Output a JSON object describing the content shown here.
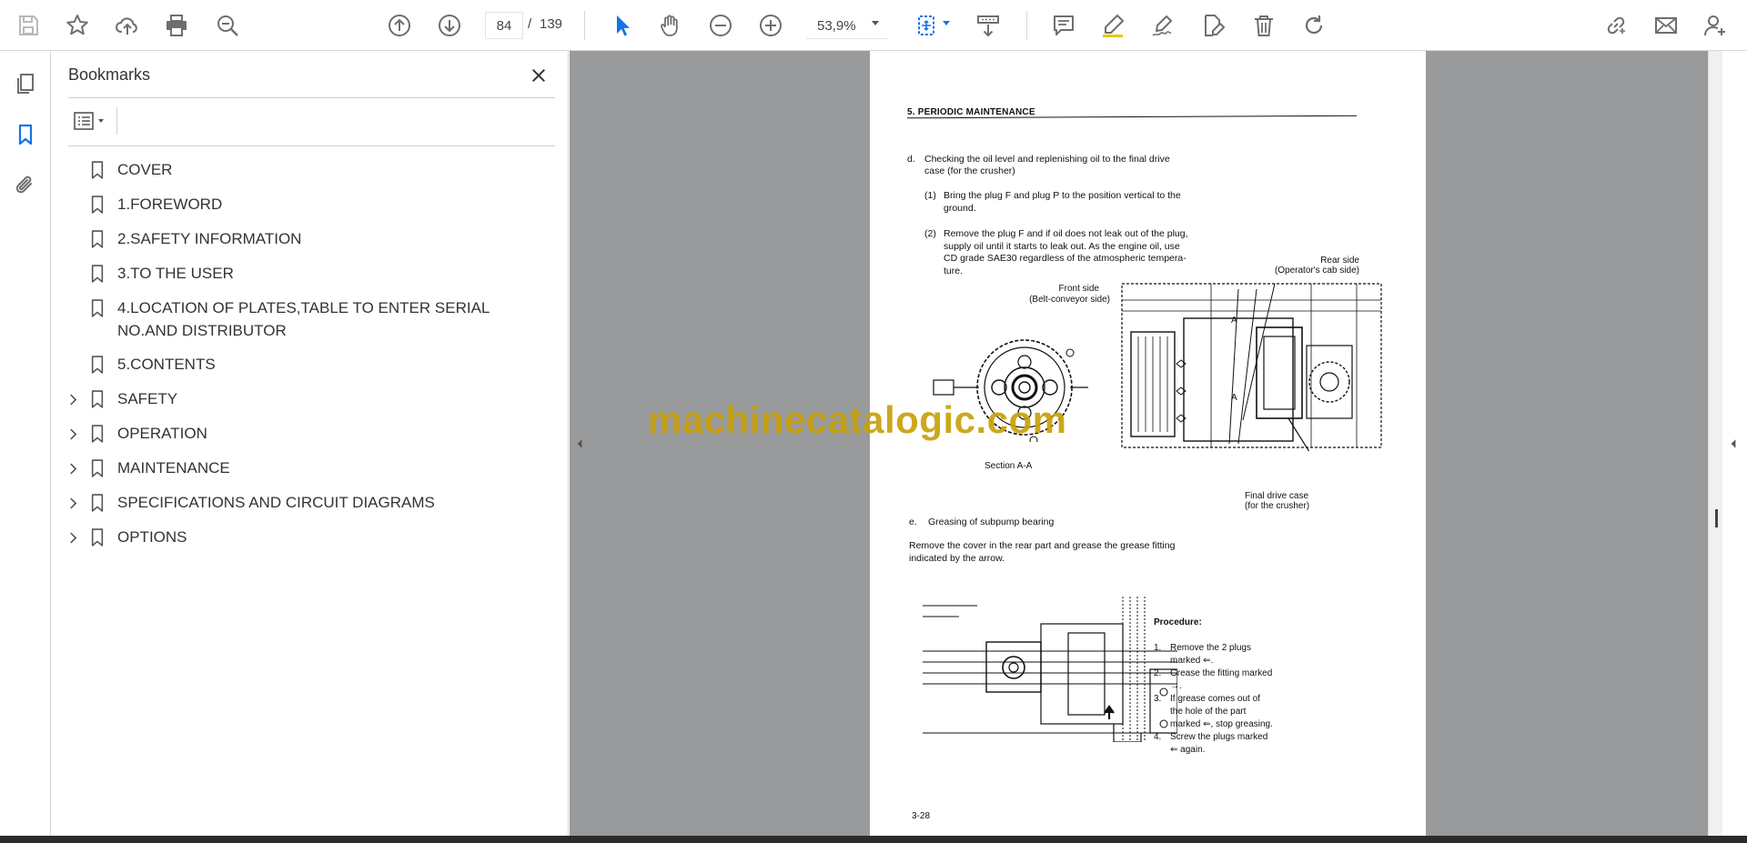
{
  "toolbar": {
    "page_current": "84",
    "page_separator": "/",
    "page_total": "139",
    "zoom": "53,9%",
    "accent_color": "#1473e6"
  },
  "left_rail": {
    "items": [
      "pages-icon",
      "bookmark-icon",
      "attachment-icon"
    ]
  },
  "bookmarks": {
    "title": "Bookmarks",
    "items": [
      {
        "label": "COVER",
        "expandable": false
      },
      {
        "label": "1.FOREWORD",
        "expandable": false
      },
      {
        "label": "2.SAFETY INFORMATION",
        "expandable": false
      },
      {
        "label": "3.TO THE USER",
        "expandable": false
      },
      {
        "label": "4.LOCATION OF PLATES,TABLE TO ENTER SERIAL NO.AND DISTRIBUTOR",
        "expandable": false
      },
      {
        "label": "5.CONTENTS",
        "expandable": false
      },
      {
        "label": "SAFETY",
        "expandable": true
      },
      {
        "label": "OPERATION",
        "expandable": true
      },
      {
        "label": "MAINTENANCE",
        "expandable": true
      },
      {
        "label": "SPECIFICATIONS AND CIRCUIT DIAGRAMS",
        "expandable": true
      },
      {
        "label": "OPTIONS",
        "expandable": true
      }
    ]
  },
  "page": {
    "header": "5.  PERIODIC MAINTENANCE",
    "d_label": "d.",
    "d_line1": "Checking the oil level and replenishing oil to the final drive",
    "d_line2": "case (for the crusher)",
    "s1_num": "(1)",
    "s1_line1": "Bring the plug F and plug P to the position vertical to the",
    "s1_line2": "ground.",
    "s2_num": "(2)",
    "s2_line1": "Remove the plug F and if oil does not leak out of the plug,",
    "s2_line2": "supply oil until it starts to leak out.  As the engine oil, use",
    "s2_line3": "CD grade SAE30 regardless of the atmospheric tempera-",
    "s2_line4": "ture.",
    "rear_side_1": "Rear side",
    "rear_side_2": "(Operator's cab side)",
    "front_side_1": "Front side",
    "front_side_2": "(Belt-conveyor side)",
    "section": "Section A-A",
    "final_drive_1": "Final drive case",
    "final_drive_2": "(for the crusher)",
    "e_label": "e.",
    "e_title": "Greasing of subpump bearing",
    "e_line1": "Remove the cover in the rear part and grease the grease fitting",
    "e_line2": "indicated by the arrow.",
    "procedure_title": "Procedure:",
    "p1_num": "1.",
    "p1_l1": "Remove the 2 plugs",
    "p1_l2": "marked ⇐.",
    "p2_num": "2.",
    "p2_l1": "Grease the fitting marked",
    "p2_l2": "→.",
    "p3_num": "3.",
    "p3_l1": "If grease comes out of",
    "p3_l2": "the hole of the part",
    "p3_l3": "marked ⇐, stop greasing.",
    "p4_num": "4.",
    "p4_l1": "Screw the plugs marked",
    "p4_l2": "⇐ again.",
    "page_number": "3-28"
  },
  "watermark": "machinecatalogic.com",
  "colors": {
    "doc_background": "#999a9c",
    "watermark": "#c9a10a",
    "icon_gray": "#6e6e6e"
  }
}
